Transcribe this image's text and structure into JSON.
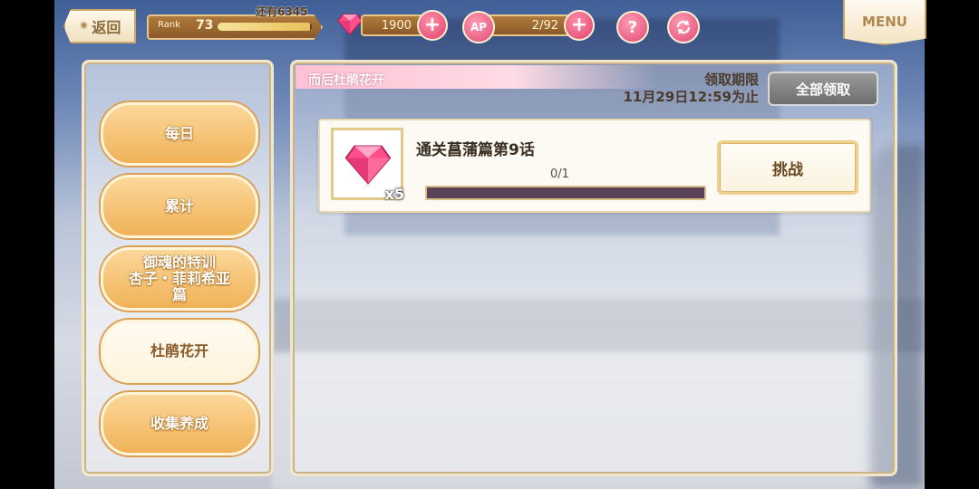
{
  "topbar": {
    "back_label": "返回",
    "rank_label": "Rank",
    "rank_value": "73",
    "rank_progress": 0.98,
    "rank_remaining": "还有6345",
    "gems": "1900",
    "ap_label": "AP",
    "ap_value": "2/92",
    "plus_glyph": "+",
    "help_glyph": "?",
    "menu_label": "MENU"
  },
  "sidebar": {
    "items": [
      {
        "label": "每日"
      },
      {
        "label": "累计"
      },
      {
        "label": "御魂的特训\n杏子・菲莉希亚\n篇"
      },
      {
        "label": "杜鹃花开"
      },
      {
        "label": "收集养成"
      }
    ]
  },
  "main": {
    "event_title": "而后杜鹃花开",
    "deadline_label": "领取期限",
    "deadline_value": "11月29日12:59为止",
    "claim_all_label": "全部领取",
    "missions": [
      {
        "title": "通关菖蒲篇第9话",
        "progress_text": "0/1",
        "progress": 0,
        "reward_icon": "pink-gem-icon",
        "reward_qty": "x5",
        "action_label": "挑战"
      }
    ]
  },
  "colors": {
    "accent_pink": "#e04872",
    "gold": "#e6c68a",
    "button_orange": "#f0b258"
  }
}
